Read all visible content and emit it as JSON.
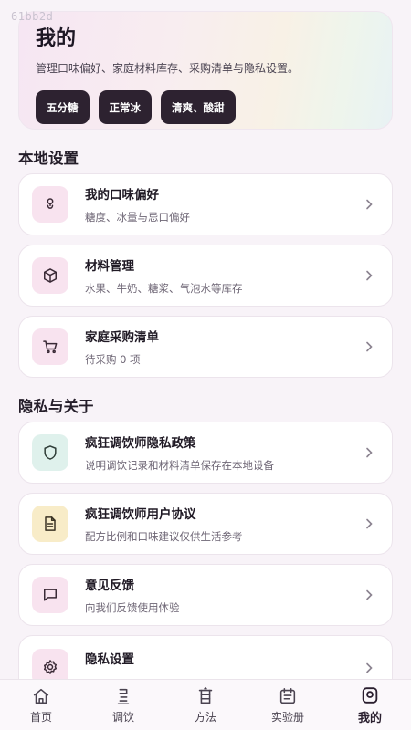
{
  "watermark": "61bb2d",
  "header": {
    "title": "我的",
    "subtitle": "管理口味偏好、家庭材料库存、采购清单与隐私设置。",
    "chips": [
      "五分糖",
      "正常冰",
      "清爽、酸甜"
    ]
  },
  "sections": {
    "local_title": "本地设置",
    "privacy_title": "隐私与关于"
  },
  "items": [
    {
      "title": "我的口味偏好",
      "subtitle": "糖度、冰量与忌口偏好",
      "icon": "taste-icon",
      "icon_bg": "#f8e3ef",
      "icon_color": "#3a2a36"
    },
    {
      "title": "材料管理",
      "subtitle": "水果、牛奶、糖浆、气泡水等库存",
      "icon": "box-icon",
      "icon_bg": "#f8e3ef",
      "icon_color": "#3a2a36"
    },
    {
      "title": "家庭采购清单",
      "subtitle": "待采购 0 项",
      "icon": "cart-icon",
      "icon_bg": "#f8e3ef",
      "icon_color": "#3a2a36"
    },
    {
      "title": "疯狂调饮师隐私政策",
      "subtitle": "说明调饮记录和材料清单保存在本地设备",
      "icon": "shield-icon",
      "icon_bg": "#dff1ec",
      "icon_color": "#2f3d38"
    },
    {
      "title": "疯狂调饮师用户协议",
      "subtitle": "配方比例和口味建议仅供生活参考",
      "icon": "document-icon",
      "icon_bg": "#f8ecc8",
      "icon_color": "#3a3324"
    },
    {
      "title": "意见反馈",
      "subtitle": "向我们反馈使用体验",
      "icon": "message-icon",
      "icon_bg": "#f8e3ef",
      "icon_color": "#3a2a36"
    },
    {
      "title": "隐私设置",
      "subtitle": "",
      "icon": "gear-icon",
      "icon_bg": "#f8e3ef",
      "icon_color": "#3a2a36"
    }
  ],
  "tabbar": [
    {
      "label": "首页",
      "icon": "home-icon",
      "active": false
    },
    {
      "label": "调饮",
      "icon": "mix-icon",
      "active": false
    },
    {
      "label": "方法",
      "icon": "method-icon",
      "active": false
    },
    {
      "label": "实验册",
      "icon": "notebook-icon",
      "active": false
    },
    {
      "label": "我的",
      "icon": "profile-icon",
      "active": true
    }
  ]
}
